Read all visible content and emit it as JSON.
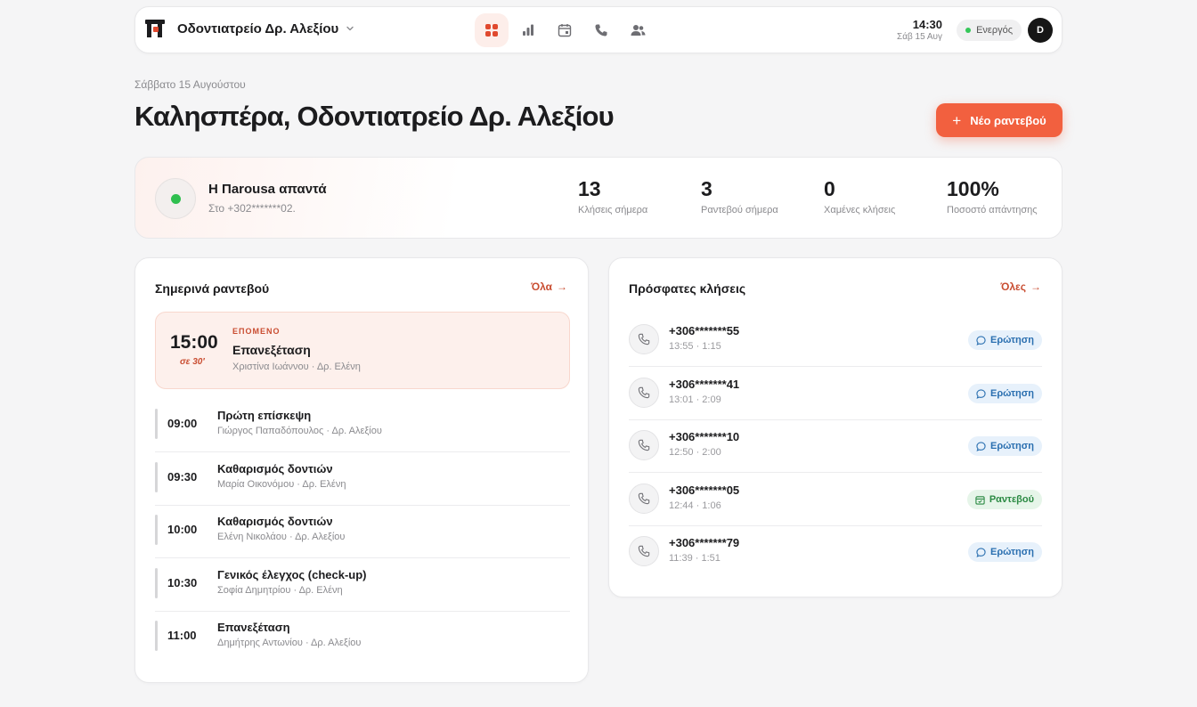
{
  "topbar": {
    "brand": "Οδοντιατρείο Δρ. Αλεξίου",
    "time": "14:30",
    "date": "Σάβ 15 Αυγ",
    "status": "Ενεργός",
    "avatar": "D",
    "nav_icons": [
      "grid-icon",
      "bar-chart-icon",
      "calendar-icon",
      "phone-icon",
      "users-icon"
    ]
  },
  "header": {
    "date_line": "Σάββατο 15 Αυγούστου",
    "greeting": "Καλησπέρα, Οδοντιατρείο Δρ. Αλεξίου",
    "new_button": "Νέο ραντεβού"
  },
  "status_card": {
    "title": "Η Πarousa απαντά",
    "subtitle": "Στο +302*******02.",
    "stats": [
      {
        "value": "13",
        "label": "Κλήσεις σήμερα"
      },
      {
        "value": "3",
        "label": "Ραντεβού σήμερα"
      },
      {
        "value": "0",
        "label": "Χαμένες κλήσεις"
      },
      {
        "value": "100%",
        "label": "Ποσοστό απάντησης"
      }
    ]
  },
  "appointments": {
    "title": "Σημερινά ραντεβού",
    "link": "Όλα",
    "next": {
      "time": "15:00",
      "in": "σε 30′",
      "tag": "ΕΠΟΜΕΝΟ",
      "title": "Επανεξέταση",
      "sub": "Χριστίνα Ιωάννου · Δρ. Ελένη"
    },
    "items": [
      {
        "time": "09:00",
        "title": "Πρώτη επίσκεψη",
        "sub": "Γιώργος Παπαδόπουλος · Δρ. Αλεξίου"
      },
      {
        "time": "09:30",
        "title": "Καθαρισμός δοντιών",
        "sub": "Μαρία Οικονόμου · Δρ. Ελένη"
      },
      {
        "time": "10:00",
        "title": "Καθαρισμός δοντιών",
        "sub": "Ελένη Νικολάου · Δρ. Αλεξίου"
      },
      {
        "time": "10:30",
        "title": "Γενικός έλεγχος (check-up)",
        "sub": "Σοφία Δημητρίου · Δρ. Ελένη"
      },
      {
        "time": "11:00",
        "title": "Επανεξέταση",
        "sub": "Δημήτρης Αντωνίου · Δρ. Αλεξίου"
      }
    ]
  },
  "calls": {
    "title": "Πρόσφατες κλήσεις",
    "link": "Όλες",
    "items": [
      {
        "number": "+306*******55",
        "meta": "13:55 · 1:15",
        "badge": "Ερώτηση"
      },
      {
        "number": "+306*******41",
        "meta": "13:01 · 2:09",
        "badge": "Ερώτηση"
      },
      {
        "number": "+306*******10",
        "meta": "12:50 · 2:00",
        "badge": "Ερώτηση"
      },
      {
        "number": "+306*******05",
        "meta": "12:44 · 1:06",
        "badge": "Ραντεβού"
      },
      {
        "number": "+306*******79",
        "meta": "11:39 · 1:51",
        "badge": "Ερώτηση"
      }
    ]
  },
  "colors": {
    "accent": "#f2603f",
    "live": "#2fbf4f",
    "badge_question": "#2a6fb0",
    "badge_appointment": "#2b8a43"
  }
}
